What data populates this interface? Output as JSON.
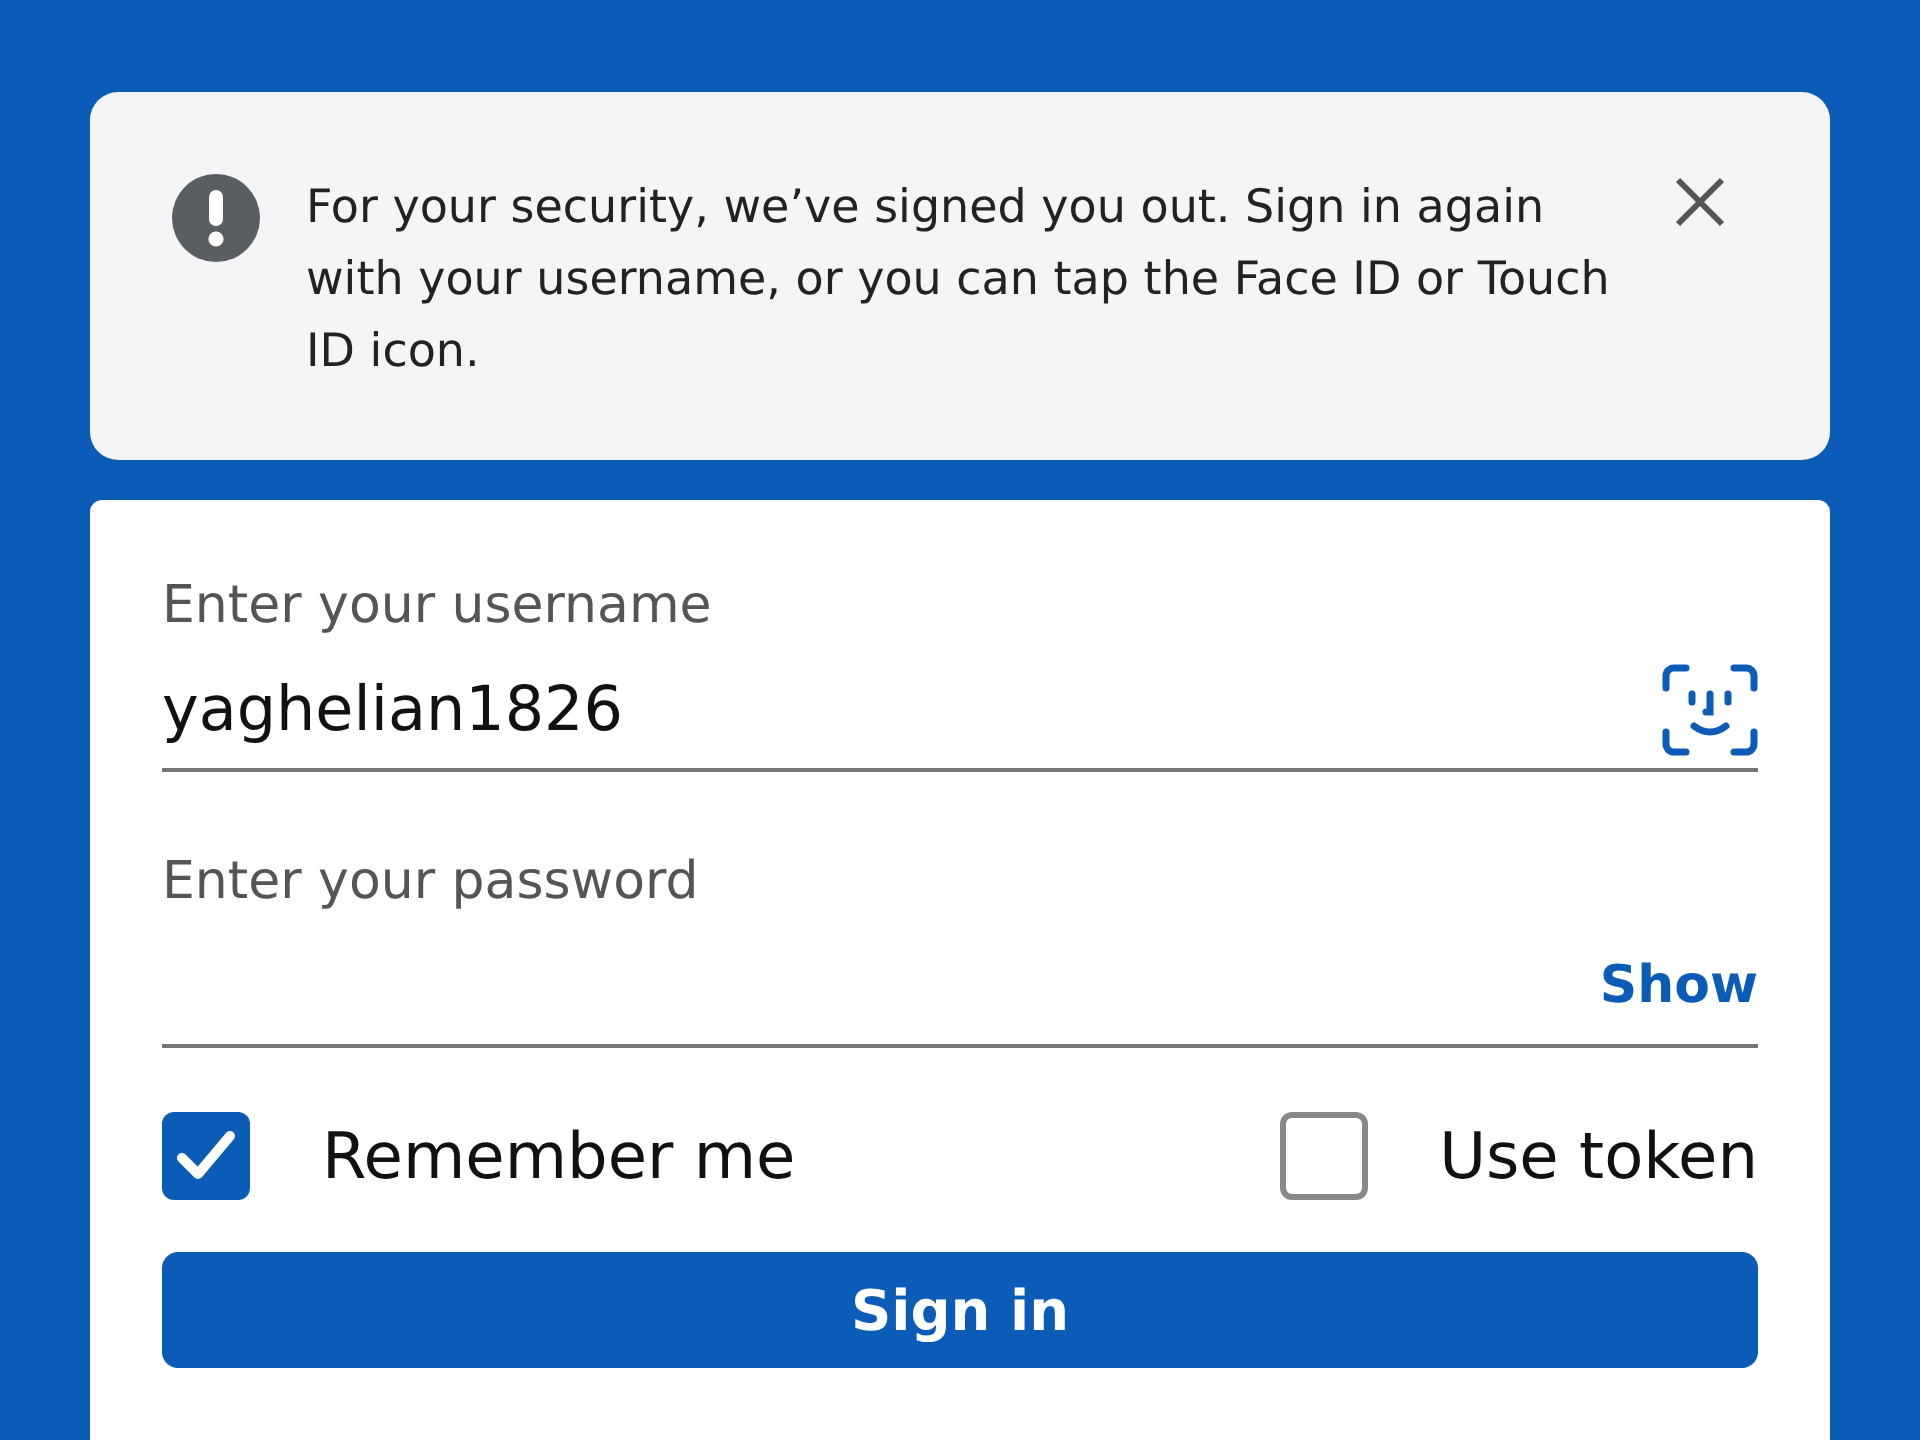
{
  "alert": {
    "message": "For your security, we’ve signed you out. Sign in again with your username, or you can tap the Face ID or Touch ID icon."
  },
  "username": {
    "label": "Enter your username",
    "value": "yaghelian1826"
  },
  "password": {
    "label": "Enter your password",
    "toggle": "Show"
  },
  "options": [
    {
      "label": "Remember me",
      "checked": true
    },
    {
      "label": "Use token",
      "checked": false
    }
  ],
  "submit": {
    "label": "Sign in"
  }
}
